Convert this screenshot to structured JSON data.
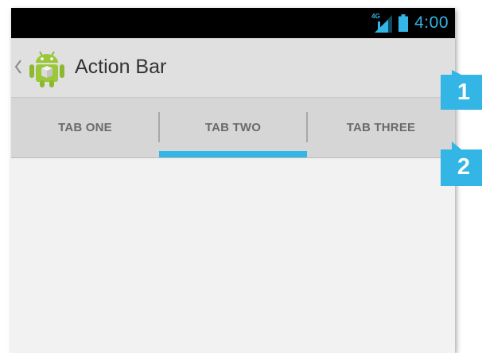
{
  "status_bar": {
    "network_type": "4G",
    "time": "4:00",
    "icon_signal": "signal-icon",
    "icon_battery": "battery-icon",
    "accent_color": "#33b5e5"
  },
  "action_bar": {
    "title": "Action Bar",
    "icon_up": "up-caret-icon",
    "icon_app": "android-app-icon"
  },
  "tabs": [
    {
      "label": "TAB ONE",
      "selected": false
    },
    {
      "label": "TAB TWO",
      "selected": true
    },
    {
      "label": "TAB THREE",
      "selected": false
    }
  ],
  "callouts": [
    {
      "number": "1"
    },
    {
      "number": "2"
    }
  ],
  "colors": {
    "indicator": "#33b5e5",
    "callout": "#33b5e5",
    "action_bar_bg": "#e0e0e0",
    "tab_bar_bg": "#d6d6d6",
    "content_bg": "#f2f2f2"
  }
}
